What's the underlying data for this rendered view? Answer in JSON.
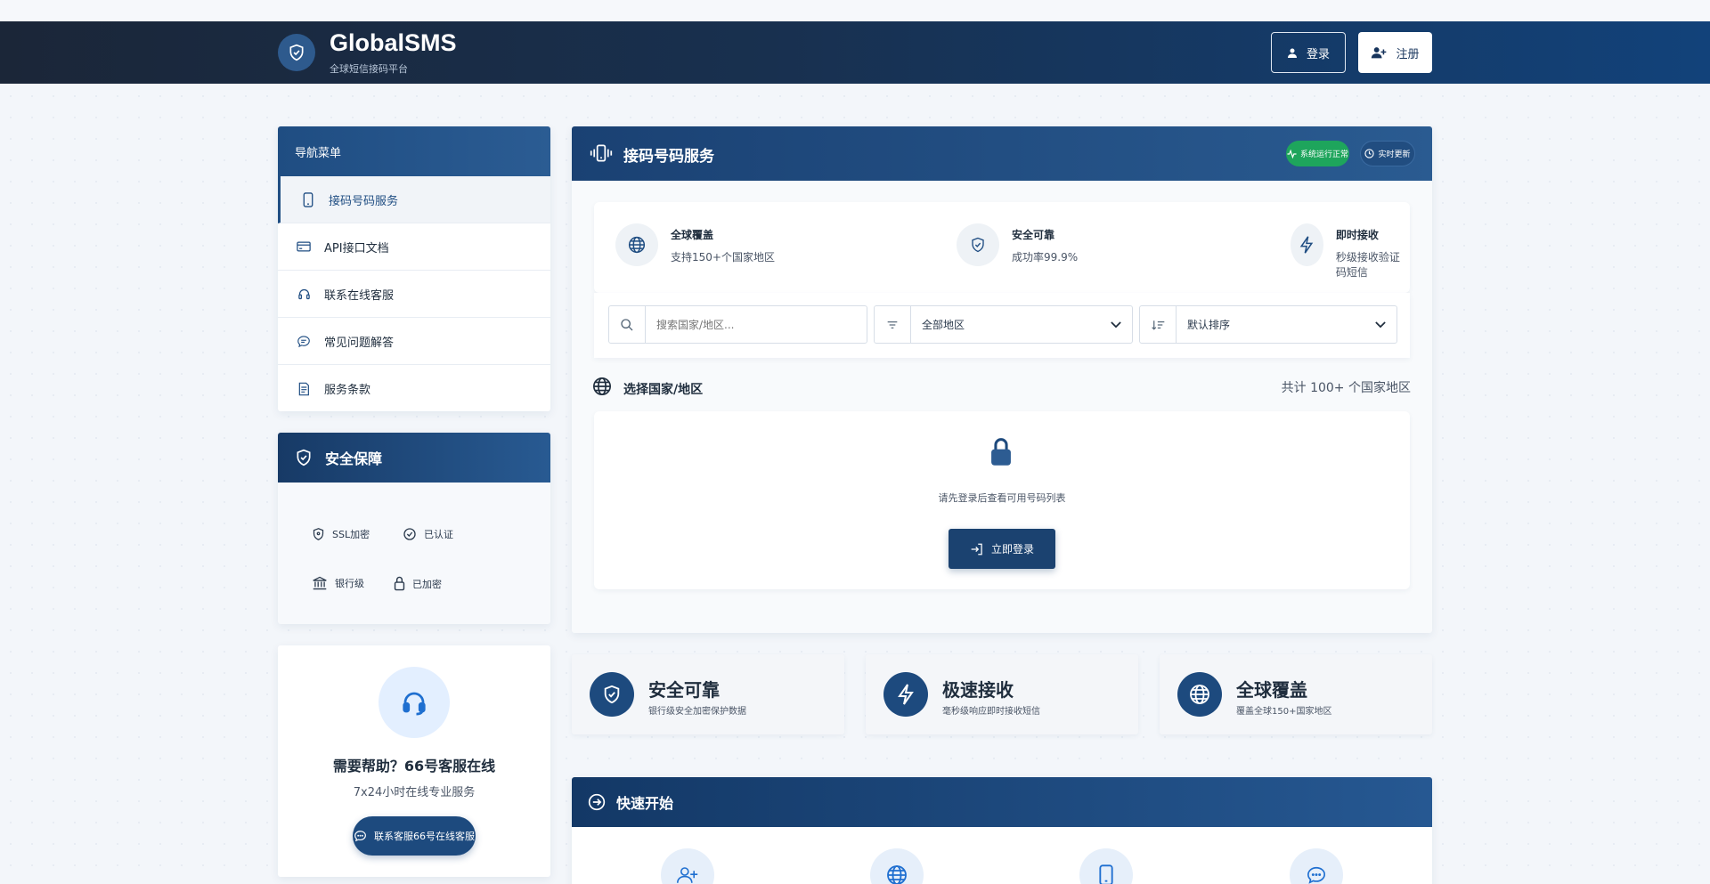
{
  "header": {
    "brand": "GlobalSMS",
    "subtitle": "全球短信接码平台",
    "login_label": "登录",
    "register_label": "注册"
  },
  "sidebar": {
    "nav_title": "导航菜单",
    "items": [
      {
        "label": "接码号码服务",
        "icon": "phone-icon",
        "active": true
      },
      {
        "label": "API接口文档",
        "icon": "card-icon"
      },
      {
        "label": "联系在线客服",
        "icon": "headset-icon"
      },
      {
        "label": "常见问题解答",
        "icon": "chat-icon"
      },
      {
        "label": "服务条款",
        "icon": "document-icon"
      }
    ],
    "security": {
      "title": "安全保障",
      "badges": [
        {
          "label": "SSL加密",
          "icon": "shield-icon"
        },
        {
          "label": "已认证",
          "icon": "check-circle-icon"
        },
        {
          "label": "银行级",
          "icon": "bank-icon"
        },
        {
          "label": "已加密",
          "icon": "lock-icon"
        }
      ]
    },
    "support": {
      "title": "需要帮助？66号客服在线",
      "subtitle": "7x24小时在线专业服务",
      "button_label": "联系客服66号在线客服"
    }
  },
  "main": {
    "title": "接码号码服务",
    "status_label": "系统运行正常",
    "time_label": "实时更新",
    "features": [
      {
        "title": "全球覆盖",
        "desc": "支持150+个国家地区",
        "icon": "globe-icon"
      },
      {
        "title": "安全可靠",
        "desc": "成功率99.9%",
        "icon": "shield-icon"
      },
      {
        "title": "即时接收",
        "desc": "秒级接收验证码短信",
        "icon": "bolt-icon"
      }
    ],
    "search": {
      "placeholder": "搜索国家/地区..."
    },
    "filter": {
      "selected": "全部地区"
    },
    "sort": {
      "selected": "默认排序"
    },
    "country_section": {
      "label": "选择国家/地区",
      "count": "共计 100+ 个国家地区"
    },
    "locked": {
      "message": "请先登录后查看可用号码列表",
      "button_label": "立即登录"
    }
  },
  "stats": [
    {
      "title": "安全可靠",
      "desc": "银行级安全加密保护数据",
      "icon": "shield-icon"
    },
    {
      "title": "极速接收",
      "desc": "毫秒级响应即时接收短信",
      "icon": "bolt-icon"
    },
    {
      "title": "全球覆盖",
      "desc": "覆盖全球150+国家地区",
      "icon": "globe-icon"
    }
  ],
  "quickstart": {
    "title": "快速开始",
    "steps": [
      {
        "icon": "user-plus-icon"
      },
      {
        "icon": "globe-icon"
      },
      {
        "icon": "phone-icon"
      },
      {
        "icon": "chat-icon"
      }
    ]
  },
  "colors": {
    "primary": "#1d4a7e",
    "success": "#1ea55c",
    "header_dark": "#1b2638"
  }
}
